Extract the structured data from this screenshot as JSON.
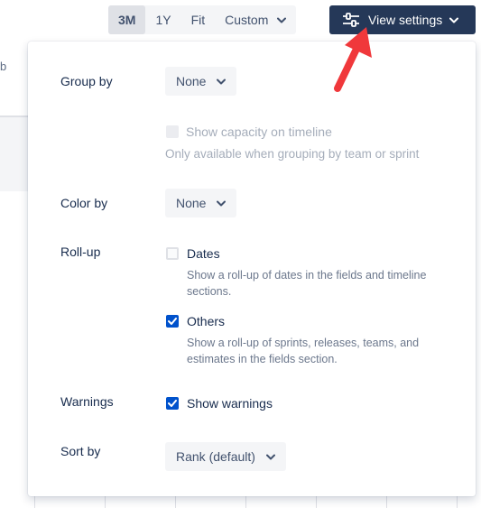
{
  "background": {
    "left_fragment": "b"
  },
  "zoom": {
    "options": [
      {
        "label": "3M",
        "active": true
      },
      {
        "label": "1Y",
        "active": false
      },
      {
        "label": "Fit",
        "active": false
      },
      {
        "label": "Custom",
        "active": false
      }
    ]
  },
  "view_settings_button": {
    "label": "View settings",
    "icon": "sliders-icon"
  },
  "panel": {
    "group_by": {
      "label": "Group by",
      "value": "None"
    },
    "capacity": {
      "label": "Show capacity on timeline",
      "checked": false,
      "disabled": true,
      "help": "Only available when grouping by team or sprint"
    },
    "color_by": {
      "label": "Color by",
      "value": "None"
    },
    "rollup": {
      "label": "Roll-up",
      "dates": {
        "label": "Dates",
        "checked": false,
        "help_line1": "Show a roll-up of dates in the fields and timeline",
        "help_line2": "sections."
      },
      "others": {
        "label": "Others",
        "checked": true,
        "help_line1": "Show a roll-up of sprints, releases, teams, and",
        "help_line2": "estimates in the fields section."
      }
    },
    "warnings": {
      "label": "Warnings",
      "checkbox_label": "Show warnings",
      "checked": true
    },
    "sort_by": {
      "label": "Sort by",
      "value": "Rank (default)"
    }
  },
  "colors": {
    "primary_button": "#253858",
    "checkbox_checked": "#0052cc",
    "annotation_arrow": "#f0383b"
  }
}
